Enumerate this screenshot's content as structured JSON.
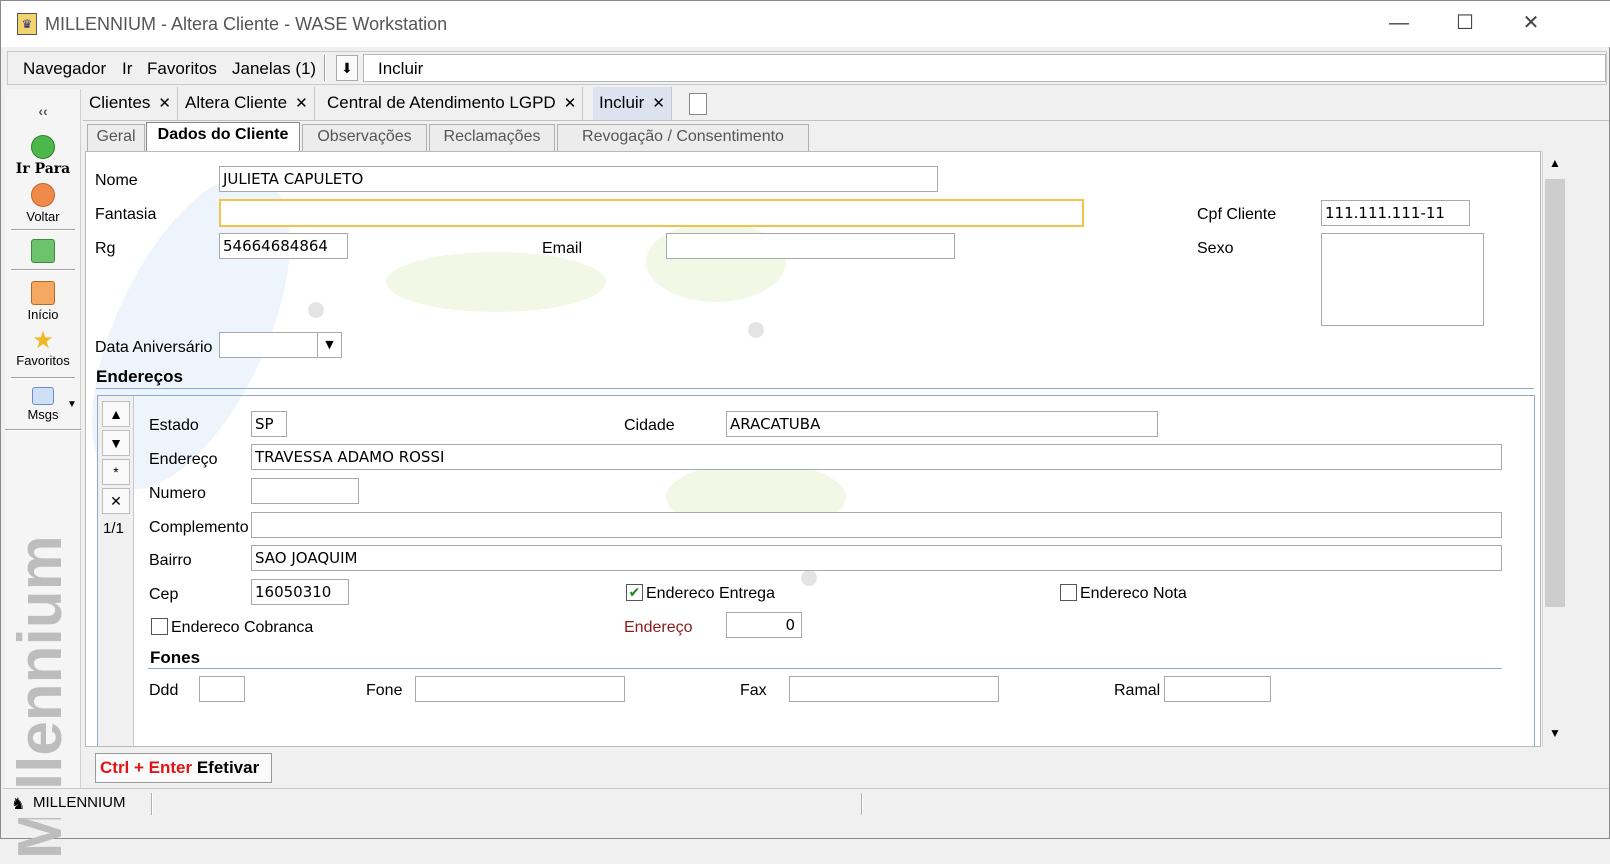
{
  "window": {
    "title": "MILLENNIUM - Altera Cliente - WASE Workstation",
    "minimize": "—",
    "maximize": "☐",
    "close": "✕"
  },
  "menubar": {
    "items": [
      "Navegador",
      "Ir",
      "Favoritos",
      "Janelas (1)"
    ],
    "action_label": "Incluir"
  },
  "sidebar": {
    "collapse": "‹‹",
    "ir_para": "Ir Para",
    "voltar": "Voltar",
    "inicio": "Início",
    "favoritos": "Favoritos",
    "msgs": "Msgs",
    "brand": "Millennium"
  },
  "doc_tabs": [
    {
      "label": "Clientes",
      "close": "✕"
    },
    {
      "label": "Altera Cliente",
      "close": "✕"
    },
    {
      "label": "Central de Atendimento LGPD",
      "close": "✕"
    },
    {
      "label": "Incluir",
      "close": "✕"
    }
  ],
  "sub_tabs": [
    "Geral",
    "Dados do Cliente",
    "Observações",
    "Reclamações",
    "Revogação / Consentimento"
  ],
  "form": {
    "nome_label": "Nome",
    "nome": "JULIETA CAPULETO",
    "fantasia_label": "Fantasia",
    "fantasia": "",
    "cpf_label": "Cpf Cliente",
    "cpf": "111.111.111-11",
    "rg_label": "Rg",
    "rg": "54664684864",
    "email_label": "Email",
    "email": "",
    "sexo_label": "Sexo",
    "sexo": "",
    "aniversario_label": "Data Aniversário",
    "aniversario": ""
  },
  "enderecos": {
    "section": "Endereços",
    "record": "1/1",
    "nav": [
      "▲",
      "▼",
      "*",
      "✕"
    ],
    "estado_label": "Estado",
    "estado": "SP",
    "cidade_label": "Cidade",
    "cidade": "ARACATUBA",
    "endereco_label": "Endereço",
    "endereco": "TRAVESSA ADAMO ROSSI",
    "numero_label": "Numero",
    "numero": "",
    "complemento_label": "Complemento",
    "complemento": "",
    "bairro_label": "Bairro",
    "bairro": "SAO JOAQUIM",
    "cep_label": "Cep",
    "cep": "16050310",
    "entrega_label": "Endereco Entrega",
    "entrega_checked": true,
    "nota_label": "Endereco Nota",
    "nota_checked": false,
    "cobranca_label": "Endereco Cobranca",
    "cobranca_checked": false,
    "endereco_num_label": "Endereço",
    "endereco_num": "0"
  },
  "fones": {
    "section": "Fones",
    "ddd_label": "Ddd",
    "ddd": "",
    "fone_label": "Fone",
    "fone": "",
    "fax_label": "Fax",
    "fax": "",
    "ramal_label": "Ramal",
    "ramal": ""
  },
  "footer": {
    "shortcut": "Ctrl + Enter",
    "action": "Efetivar"
  },
  "statusbar": {
    "text": "MILLENNIUM"
  },
  "colors": {
    "focus_border": "#f0c34c",
    "shortcut_red": "#e01515",
    "check_green": "#1a8a1a",
    "active_tab": "#dce3ef"
  }
}
